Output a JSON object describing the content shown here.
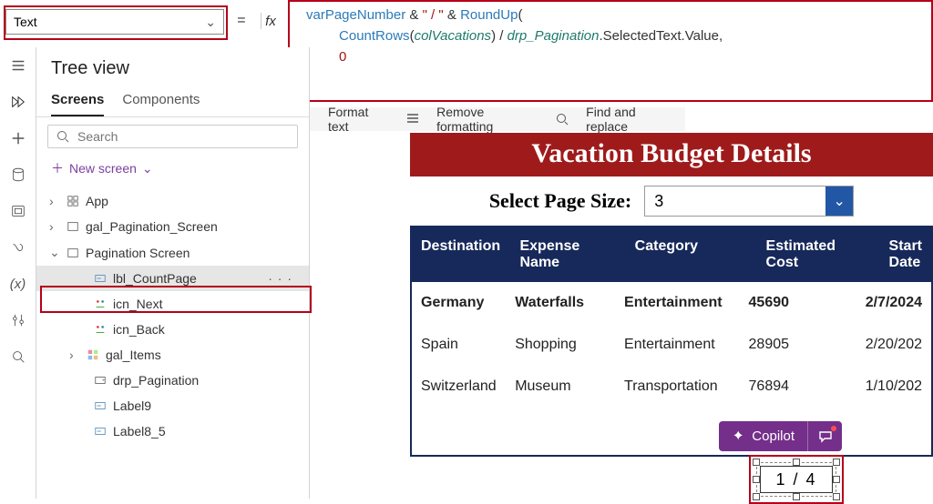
{
  "property_selector": {
    "value": "Text"
  },
  "formula": {
    "raw": "varPageNumber & \" / \" & RoundUp(\n    CountRows(colVacations) / drp_Pagination.SelectedText.Value,\n    0\n)",
    "tokens": {
      "varPageNumber": "varPageNumber",
      "amp1": " & ",
      "str": "\" / \"",
      "amp2": " & ",
      "RoundUp": "RoundUp",
      "open": "(",
      "CountRows": "CountRows",
      "open2": "(",
      "colVacations": "colVacations",
      "close2": ")",
      "div": " / ",
      "drp": "drp_Pagination",
      "dot": ".SelectedText.Value,",
      "zero": "0",
      "close": ")"
    }
  },
  "format_bar": {
    "format": "Format text",
    "remove": "Remove formatting",
    "find": "Find and replace"
  },
  "panel": {
    "title": "Tree view",
    "tabs": {
      "screens": "Screens",
      "components": "Components"
    },
    "search_placeholder": "Search",
    "new_screen": "New screen"
  },
  "tree": {
    "app": "App",
    "gal_pag_screen": "gal_Pagination_Screen",
    "pagination_screen": "Pagination Screen",
    "lbl_countpage": "lbl_CountPage",
    "icn_next": "icn_Next",
    "icn_back": "icn_Back",
    "gal_items": "gal_Items",
    "drp_pagination": "drp_Pagination",
    "label9": "Label9",
    "label8_5": "Label8_5"
  },
  "app": {
    "title": "Vacation Budget Details",
    "page_size_label": "Select Page Size:",
    "page_size_value": "3",
    "columns": {
      "c1": "Destination",
      "c2": "Expense Name",
      "c3": "Category",
      "c4": "Estimated Cost",
      "c5": "Start Date"
    },
    "rows": [
      {
        "c1": "Germany",
        "c2": "Waterfalls",
        "c3": "Entertainment",
        "c4": "45690",
        "c5": "2/7/2024"
      },
      {
        "c1": "Spain",
        "c2": "Shopping",
        "c3": "Entertainment",
        "c4": "28905",
        "c5": "2/20/202"
      },
      {
        "c1": "Switzerland",
        "c2": "Museum",
        "c3": "Transportation",
        "c4": "76894",
        "c5": "1/10/202"
      }
    ],
    "copilot": "Copilot",
    "pager": "1 / 4"
  }
}
